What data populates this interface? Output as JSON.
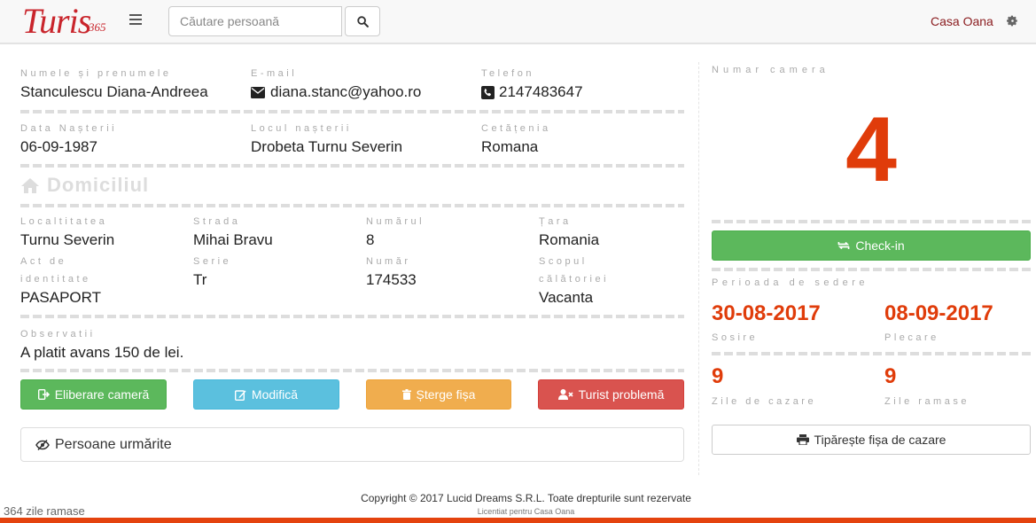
{
  "navbar": {
    "logo_text": "Turis",
    "logo_number": "365",
    "search_placeholder": "Căutare persoană",
    "user_name": "Casa Oana"
  },
  "person": {
    "name_label": "Numele și prenumele",
    "name": "Stanculescu Diana-Andreea",
    "email_label": "E-mail",
    "email": "diana.stanc@yahoo.ro",
    "phone_label": "Telefon",
    "phone": "2147483647",
    "birth_date_label": "Data Nașterii",
    "birth_date": "06-09-1987",
    "birth_place_label": "Locul nașterii",
    "birth_place": "Drobeta Turnu Severin",
    "citizenship_label": "Cetățenia",
    "citizenship": "Romana"
  },
  "address": {
    "title": "Domiciliul",
    "locality_label": "Localtitatea",
    "locality": "Turnu Severin",
    "street_label": "Strada",
    "street": "Mihai Bravu",
    "number_label": "Numărul",
    "number": "8",
    "country_label": "Țara",
    "country": "Romania",
    "id_doc_label_1": "Act de",
    "id_doc_label_2": "identitate",
    "id_doc": "PASAPORT",
    "series_label": "Serie",
    "series": "Tr",
    "doc_number_label": "Număr",
    "doc_number": "174533",
    "purpose_label_1": "Scopul",
    "purpose_label_2": "călătoriei",
    "purpose": "Vacanta",
    "notes_label": "Observatii",
    "notes": "A platit avans 150 de lei."
  },
  "actions": {
    "release_room": "Eliberare cameră",
    "edit": "Modifică",
    "delete": "Șterge fișa",
    "problem_tourist": "Turist problemă",
    "watched_persons": "Persoane urmărite"
  },
  "room": {
    "label": "Numar camera",
    "number": "4",
    "checkin_button": "Check-in",
    "period_label": "Perioada de sedere",
    "arrival": "30-08-2017",
    "arrival_label": "Sosire",
    "departure": "08-09-2017",
    "departure_label": "Plecare",
    "nights": "9",
    "nights_label": "Zile de cazare",
    "remaining": "9",
    "remaining_label": "Zile ramase",
    "print_button": "Tipărește fișa de cazare"
  },
  "footer": {
    "copyright": "Copyright © 2017 Lucid Dreams S.R.L. Toate drepturile sunt rezervate",
    "license": "Licentiat pentru Casa Oana",
    "days_left": "364 zile ramase"
  },
  "colors": {
    "brand": "#c9252c",
    "accent": "#e03c0a",
    "green": "#5cb85c",
    "blue": "#5bc0de",
    "orange": "#f0ad4e",
    "red": "#d9534f"
  }
}
